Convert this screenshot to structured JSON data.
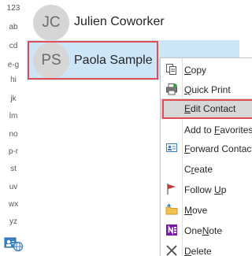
{
  "index_bar": {
    "items": [
      "123",
      "ab",
      "cd",
      "e-g",
      "hi",
      "jk",
      "lm",
      "no",
      "p-r",
      "st",
      "uv",
      "wx",
      "yz"
    ],
    "view_toggle_icon": "contact-card-globe-icon"
  },
  "contacts": [
    {
      "initials": "JC",
      "name": "Julien Coworker"
    },
    {
      "initials": "PS",
      "name": "Paola Sample",
      "selected": true
    }
  ],
  "context_menu": {
    "items": [
      {
        "before": "",
        "key": "C",
        "after": "opy",
        "icon": "copy-icon"
      },
      {
        "before": "",
        "key": "Q",
        "after": "uick Print",
        "icon": "print-icon"
      },
      {
        "before": "",
        "key": "E",
        "after": "dit Contact",
        "icon": "",
        "highlighted": true
      },
      {
        "before": "Add to ",
        "key": "F",
        "after": "avorites",
        "icon": ""
      },
      {
        "before": "",
        "key": "F",
        "after": "orward Contact",
        "icon": "forward-contact-icon"
      },
      {
        "before": "C",
        "key": "r",
        "after": "eate",
        "icon": ""
      },
      {
        "before": "Follow ",
        "key": "U",
        "after": "p",
        "icon": "flag-icon"
      },
      {
        "before": "",
        "key": "M",
        "after": "ove",
        "icon": "move-folder-icon"
      },
      {
        "before": "One",
        "key": "N",
        "after": "ote",
        "icon": "onenote-icon"
      },
      {
        "before": "",
        "key": "D",
        "after": "elete",
        "icon": "delete-icon"
      }
    ]
  },
  "colors": {
    "selection": "#cde6f7",
    "highlight_outline": "#e04e54",
    "menu_hover": "#d7d7d7"
  }
}
